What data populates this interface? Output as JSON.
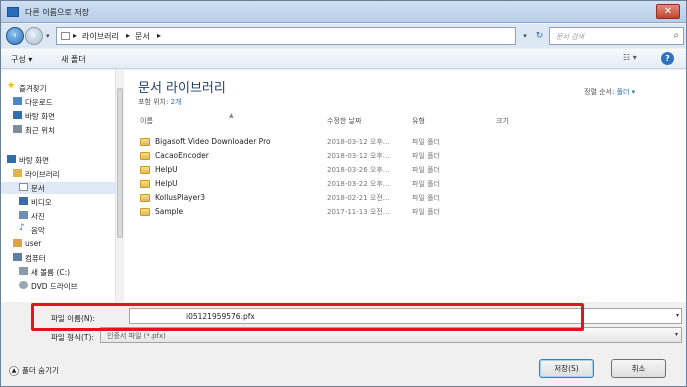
{
  "window": {
    "title": "다른 이름으로 저장",
    "close_label": "✕"
  },
  "address": {
    "crumbs": [
      "라이브러리",
      "문서"
    ],
    "search_placeholder": "문서 검색"
  },
  "toolbar": {
    "organize_label": "구성 ▾",
    "new_folder_label": "새 폴더",
    "view_label": "☷ ▾",
    "help_label": "?"
  },
  "nav": {
    "items": [
      {
        "label": "즐겨찾기",
        "icon": "star-icon",
        "color": "#f2b619"
      },
      {
        "label": "다운로드",
        "icon": "download-folder-icon",
        "color": "#4a86c8"
      },
      {
        "label": "바탕 화면",
        "icon": "desktop-icon",
        "color": "#2f6fb1"
      },
      {
        "label": "최근 위치",
        "icon": "recent-icon",
        "color": "#7e8c9b"
      },
      {
        "label": "바탕 화면",
        "icon": "desktop-icon",
        "color": "#2f6fb1"
      },
      {
        "label": "라이브러리",
        "icon": "library-icon",
        "color": "#e2b34a"
      },
      {
        "label": "문서",
        "icon": "document-icon",
        "color": "#cfd8e3"
      },
      {
        "label": "비디오",
        "icon": "video-icon",
        "color": "#3a6da8"
      },
      {
        "label": "사진",
        "icon": "picture-icon",
        "color": "#6d8fb3"
      },
      {
        "label": "음악",
        "icon": "music-icon",
        "color": "#2f6fb1"
      },
      {
        "label": "user",
        "icon": "user-icon",
        "color": "#d9a441"
      },
      {
        "label": "컴퓨터",
        "icon": "computer-icon",
        "color": "#5b7fa6"
      },
      {
        "label": "새 볼륨 (C:)",
        "icon": "drive-icon",
        "color": "#8a9aaa"
      },
      {
        "label": "DVD 드라이브",
        "icon": "dvd-drive-icon",
        "color": "#9aa7b4"
      }
    ]
  },
  "content": {
    "title": "문서 라이브러리",
    "subtitle_prefix": "포함 위치:",
    "subtitle_locations": "2개",
    "arrange_label": "정렬 순서:",
    "arrange_value": "폴더 ▾",
    "columns": [
      "이름",
      "수정한 날짜",
      "유형",
      "크기"
    ],
    "rows": [
      {
        "name": "Bigasoft Video Downloader Pro",
        "date": "2018-03-12 오후...",
        "type": "파일 폴더"
      },
      {
        "name": "CacaoEncoder",
        "date": "2018-03-12 오후...",
        "type": "파일 폴더"
      },
      {
        "name": "HelpU",
        "date": "2018-03-26 오후...",
        "type": "파일 폴더"
      },
      {
        "name": "HelpU",
        "date": "2018-03-22 오후...",
        "type": "파일 폴더"
      },
      {
        "name": "KollusPlayer3",
        "date": "2018-02-21 오전...",
        "type": "파일 폴더"
      },
      {
        "name": "Sample",
        "date": "2017-11-13 오전...",
        "type": "파일 폴더"
      }
    ]
  },
  "bottom": {
    "filename_label": "파일 이름(N):",
    "filename_value": "i05121959576.pfx",
    "filetype_label": "파일 형식(T):",
    "filetype_value": "인증서 파일 (*.pfx)",
    "hide_folders_label": "폴더 숨기기",
    "save_label": "저장(S)",
    "cancel_label": "취소"
  },
  "colors": {
    "highlight": "#e0161f",
    "title_blue": "#1e3f75",
    "folder": "#e7b94c"
  }
}
